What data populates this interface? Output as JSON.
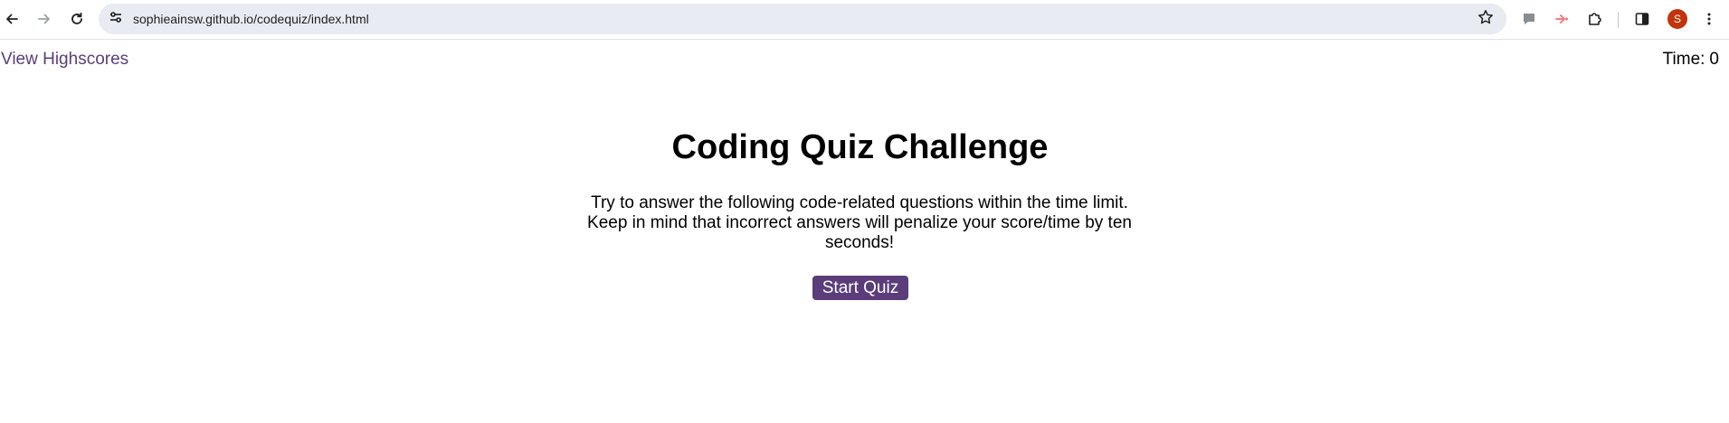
{
  "browser": {
    "url": "sophieainsw.github.io/codequiz/index.html",
    "avatar_initial": "S",
    "icons": {
      "back": "arrow-left-icon",
      "forward": "arrow-right-icon",
      "reload": "reload-icon",
      "site_info": "tune-icon",
      "bookmark": "star-icon",
      "extension_1": "chat-bubble-icon",
      "extension_2": "share-arrow-icon",
      "extensions": "puzzle-icon",
      "side_panel": "side-panel-icon",
      "menu": "kebab-menu-icon"
    },
    "colors": {
      "omnibox_bg": "#e9ebf3",
      "avatar_bg": "#c2340c",
      "extension_2": "#f08080"
    }
  },
  "page": {
    "highscores_link": "View Highscores",
    "timer_label": "Time:",
    "timer_value": "0",
    "title": "Coding Quiz Challenge",
    "intro": "Try to answer the following code-related questions within the time limit. Keep in mind that incorrect answers will penalize your score/time by ten seconds!",
    "start_button": "Start Quiz",
    "colors": {
      "accent": "#5a3d7a",
      "text": "#000000"
    }
  }
}
